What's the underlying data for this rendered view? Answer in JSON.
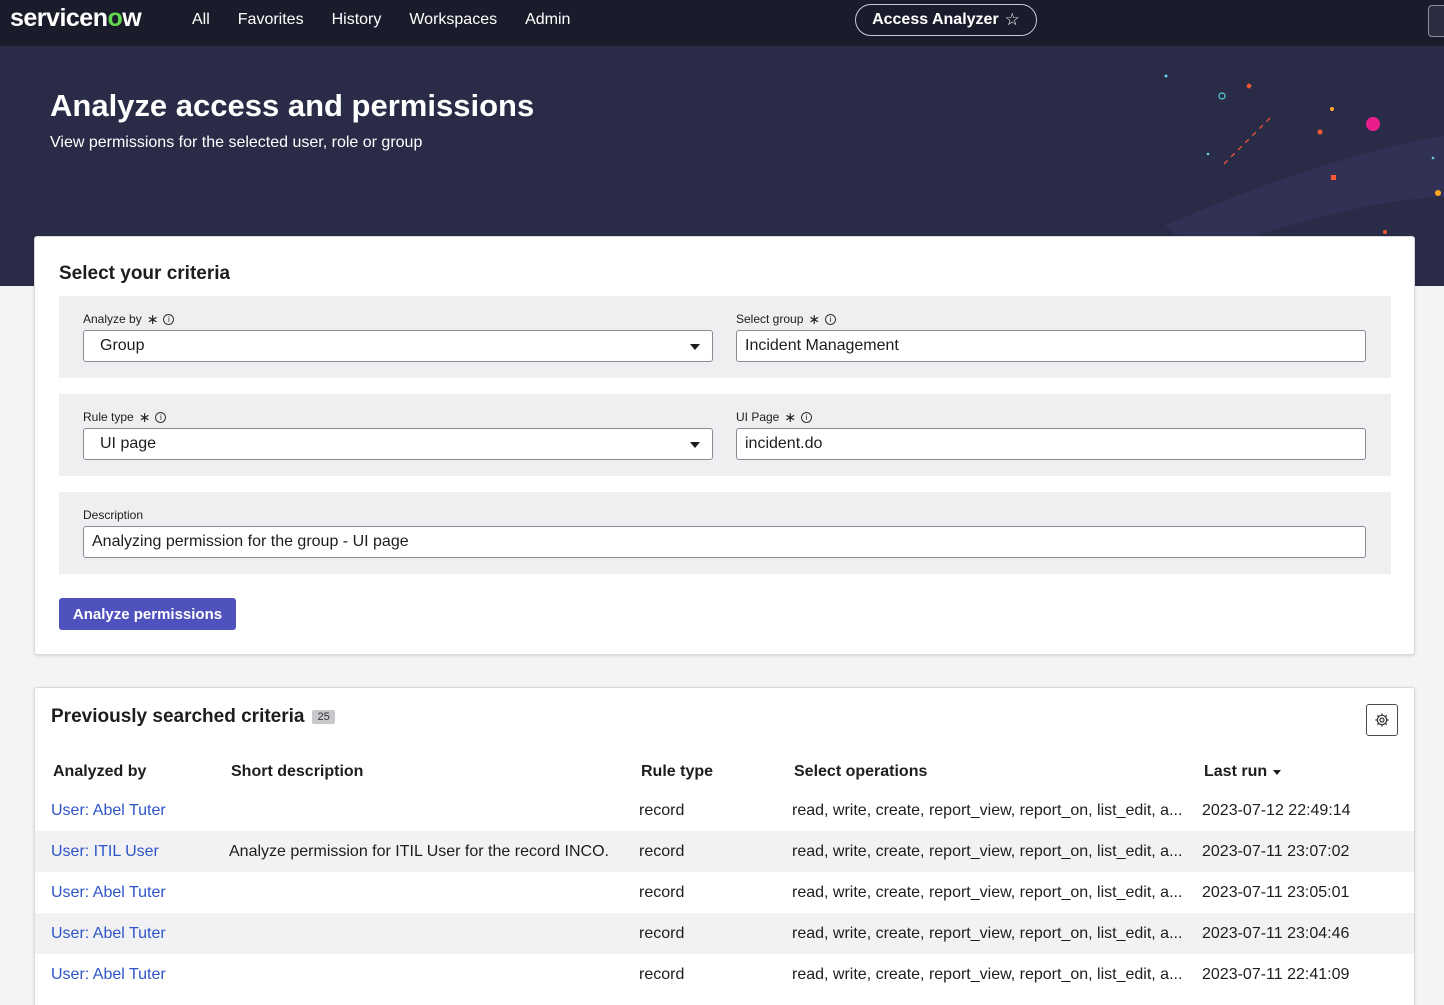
{
  "nav": {
    "logo_prefix": "servicen",
    "logo_o": "o",
    "logo_suffix": "w",
    "items": [
      "All",
      "Favorites",
      "History",
      "Workspaces",
      "Admin"
    ],
    "app_pill": "Access Analyzer",
    "star_icon": "☆"
  },
  "hero": {
    "title": "Analyze access and permissions",
    "subtitle": "View permissions for the selected user, role or group"
  },
  "criteria": {
    "title": "Select your criteria",
    "analyze_by": {
      "label": "Analyze by",
      "value": "Group"
    },
    "select_group": {
      "label": "Select group",
      "value": "Incident Management"
    },
    "rule_type": {
      "label": "Rule type",
      "value": "UI page"
    },
    "ui_page": {
      "label": "UI Page",
      "value": "incident.do"
    },
    "description": {
      "label": "Description",
      "value": "Analyzing permission for the group - UI page"
    },
    "required_mark": "∗",
    "info_mark": "i",
    "submit_label": "Analyze permissions"
  },
  "previous": {
    "title": "Previously searched criteria",
    "count": "25",
    "columns": [
      "Analyzed by",
      "Short description",
      "Rule type",
      "Select operations",
      "Last run"
    ],
    "rows": [
      {
        "analyzed_by": "User: Abel Tuter",
        "short_description": "",
        "rule_type": "record",
        "operations": "read, write, create, report_view, report_on, list_edit, a...",
        "last_run": "2023-07-12 22:49:14"
      },
      {
        "analyzed_by": "User: ITIL User",
        "short_description": "Analyze permission for ITIL User for the record INCO...",
        "rule_type": "record",
        "operations": "read, write, create, report_view, report_on, list_edit, a...",
        "last_run": "2023-07-11 23:07:02"
      },
      {
        "analyzed_by": "User: Abel Tuter",
        "short_description": "",
        "rule_type": "record",
        "operations": "read, write, create, report_view, report_on, list_edit, a...",
        "last_run": "2023-07-11 23:05:01"
      },
      {
        "analyzed_by": "User: Abel Tuter",
        "short_description": "",
        "rule_type": "record",
        "operations": "read, write, create, report_view, report_on, list_edit, a...",
        "last_run": "2023-07-11 23:04:46"
      },
      {
        "analyzed_by": "User: Abel Tuter",
        "short_description": "",
        "rule_type": "record",
        "operations": "read, write, create, report_view, report_on, list_edit, a...",
        "last_run": "2023-07-11 22:41:09"
      }
    ]
  },
  "colors": {
    "nav_bg": "#1b1c2b",
    "hero_bg": "#2a2b46",
    "primary_button": "#4f52bd",
    "link": "#2d55c7",
    "accent_green": "#62d84e"
  }
}
